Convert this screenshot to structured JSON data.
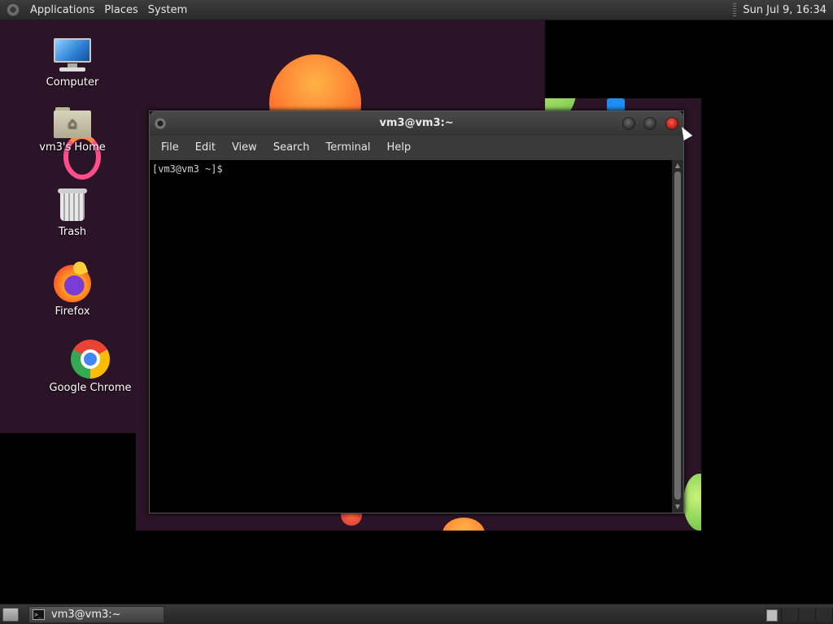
{
  "top_panel": {
    "menus": [
      "Applications",
      "Places",
      "System"
    ],
    "clock": "Sun Jul  9, 16:34"
  },
  "desktop": {
    "icons": [
      {
        "label": "Computer",
        "icon": "computer-icon"
      },
      {
        "label": "vm3's Home",
        "icon": "home-folder-icon"
      },
      {
        "label": "Trash",
        "icon": "trash-icon"
      },
      {
        "label": "Firefox",
        "icon": "firefox-icon"
      },
      {
        "label": "Google Chrome",
        "icon": "chrome-icon"
      }
    ]
  },
  "terminal": {
    "title": "vm3@vm3:~",
    "menu": [
      "File",
      "Edit",
      "View",
      "Search",
      "Terminal",
      "Help"
    ],
    "prompt": "[vm3@vm3 ~]$"
  },
  "taskbar": {
    "task_label": "vm3@vm3:~",
    "workspaces": 4,
    "active_workspace": 1
  },
  "colors": {
    "wallpaper": "#2b1427",
    "close_button": "#d6281c"
  }
}
